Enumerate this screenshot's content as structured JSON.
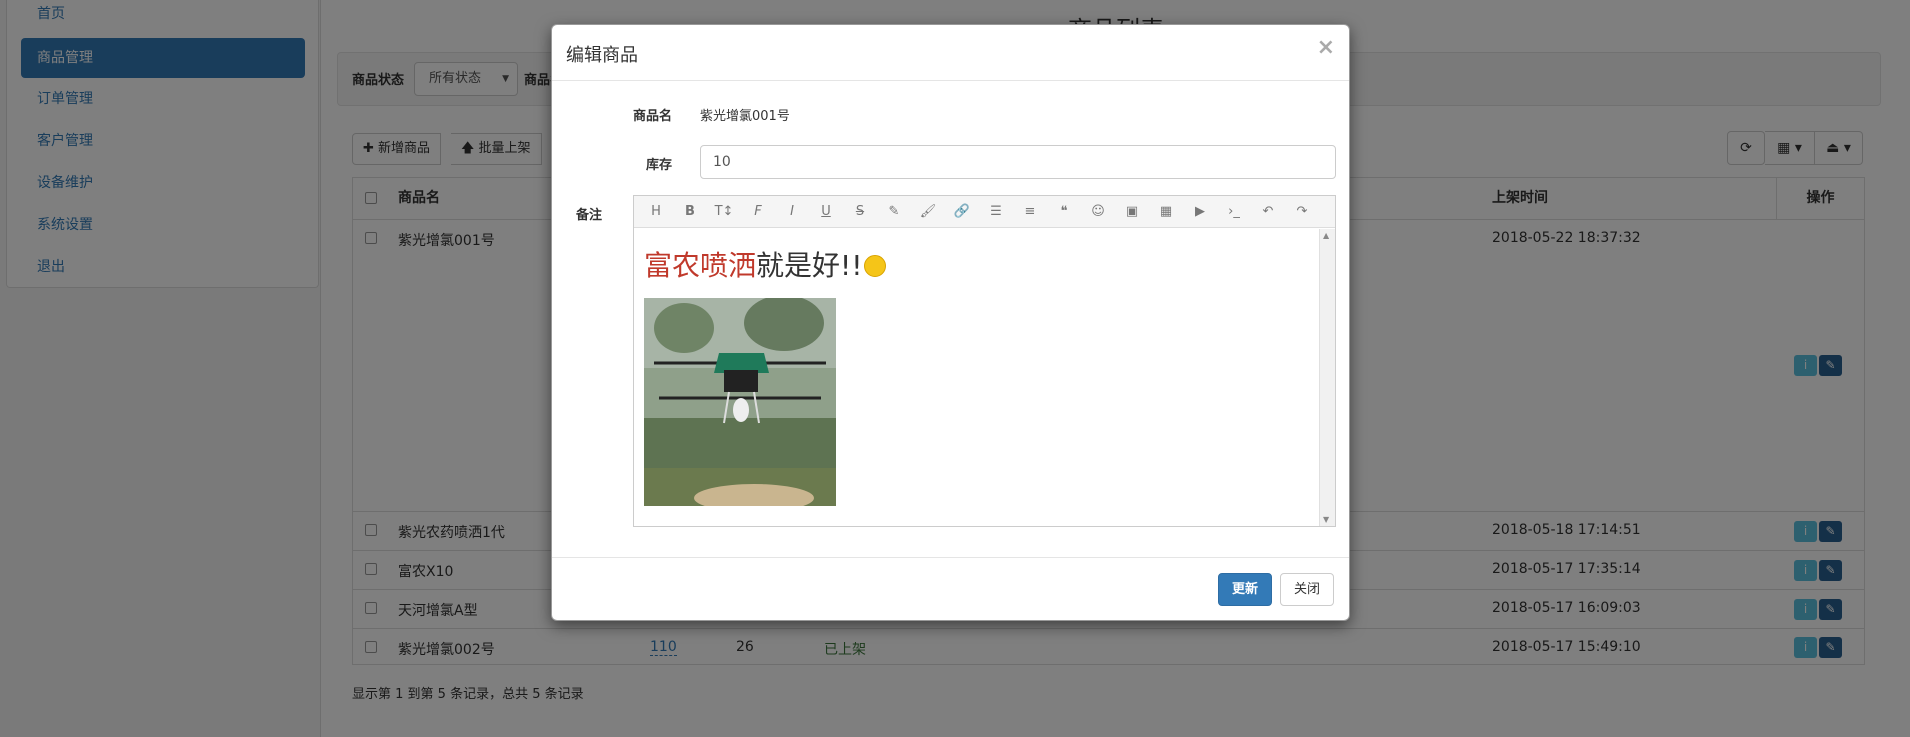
{
  "sidebar": {
    "items": [
      {
        "label": "首页"
      },
      {
        "label": "商品管理",
        "active": true
      },
      {
        "label": "订单管理"
      },
      {
        "label": "客户管理"
      },
      {
        "label": "设备维护"
      },
      {
        "label": "系统设置"
      },
      {
        "label": "退出"
      }
    ]
  },
  "main": {
    "title": "商品列表",
    "filters": {
      "status_label": "商品状态",
      "status_value": "所有状态",
      "name_label": "商品名"
    },
    "toolbar": {
      "add_label": "新增商品",
      "batch_label": "批量上架"
    },
    "table": {
      "headers": [
        "商品名",
        "上架时间",
        "操作"
      ],
      "rows": [
        {
          "name": "紫光增氯001号",
          "time": "2018-05-22 18:37:32"
        },
        {
          "name": "紫光农药喷洒1代",
          "time": "2018-05-18 17:14:51"
        },
        {
          "name": "富农X10",
          "time": "2018-05-17 17:35:14"
        },
        {
          "name": "天河增氯A型",
          "time": "2018-05-17 16:09:03"
        },
        {
          "name": "紫光增氯002号",
          "price": "110",
          "stock": "26",
          "status": "已上架",
          "time": "2018-05-17 15:49:10"
        }
      ]
    },
    "footer": "显示第 1 到第 5 条记录，总共 5 条记录"
  },
  "modal": {
    "title": "编辑商品",
    "close_glyph": "×",
    "fields": {
      "name_label": "商品名",
      "name_value": "紫光增氯001号",
      "stock_label": "库存",
      "stock_value": "10",
      "note_label": "备注"
    },
    "editor": {
      "red_text": "富农喷洒",
      "rest_text": "就是好!!",
      "tools": [
        "H",
        "B",
        "T↕",
        "F",
        "I",
        "U",
        "S",
        "✎",
        "🖌",
        "🔗",
        "☰",
        "≡",
        "❝",
        "☺",
        "▣",
        "▦",
        "▶",
        "›_",
        "↶",
        "↷"
      ]
    },
    "update_label": "更新",
    "close_label": "关闭"
  },
  "colors": {
    "primary": "#337ab7",
    "info": "#5bc0de",
    "active_nav": "#337ab7"
  }
}
